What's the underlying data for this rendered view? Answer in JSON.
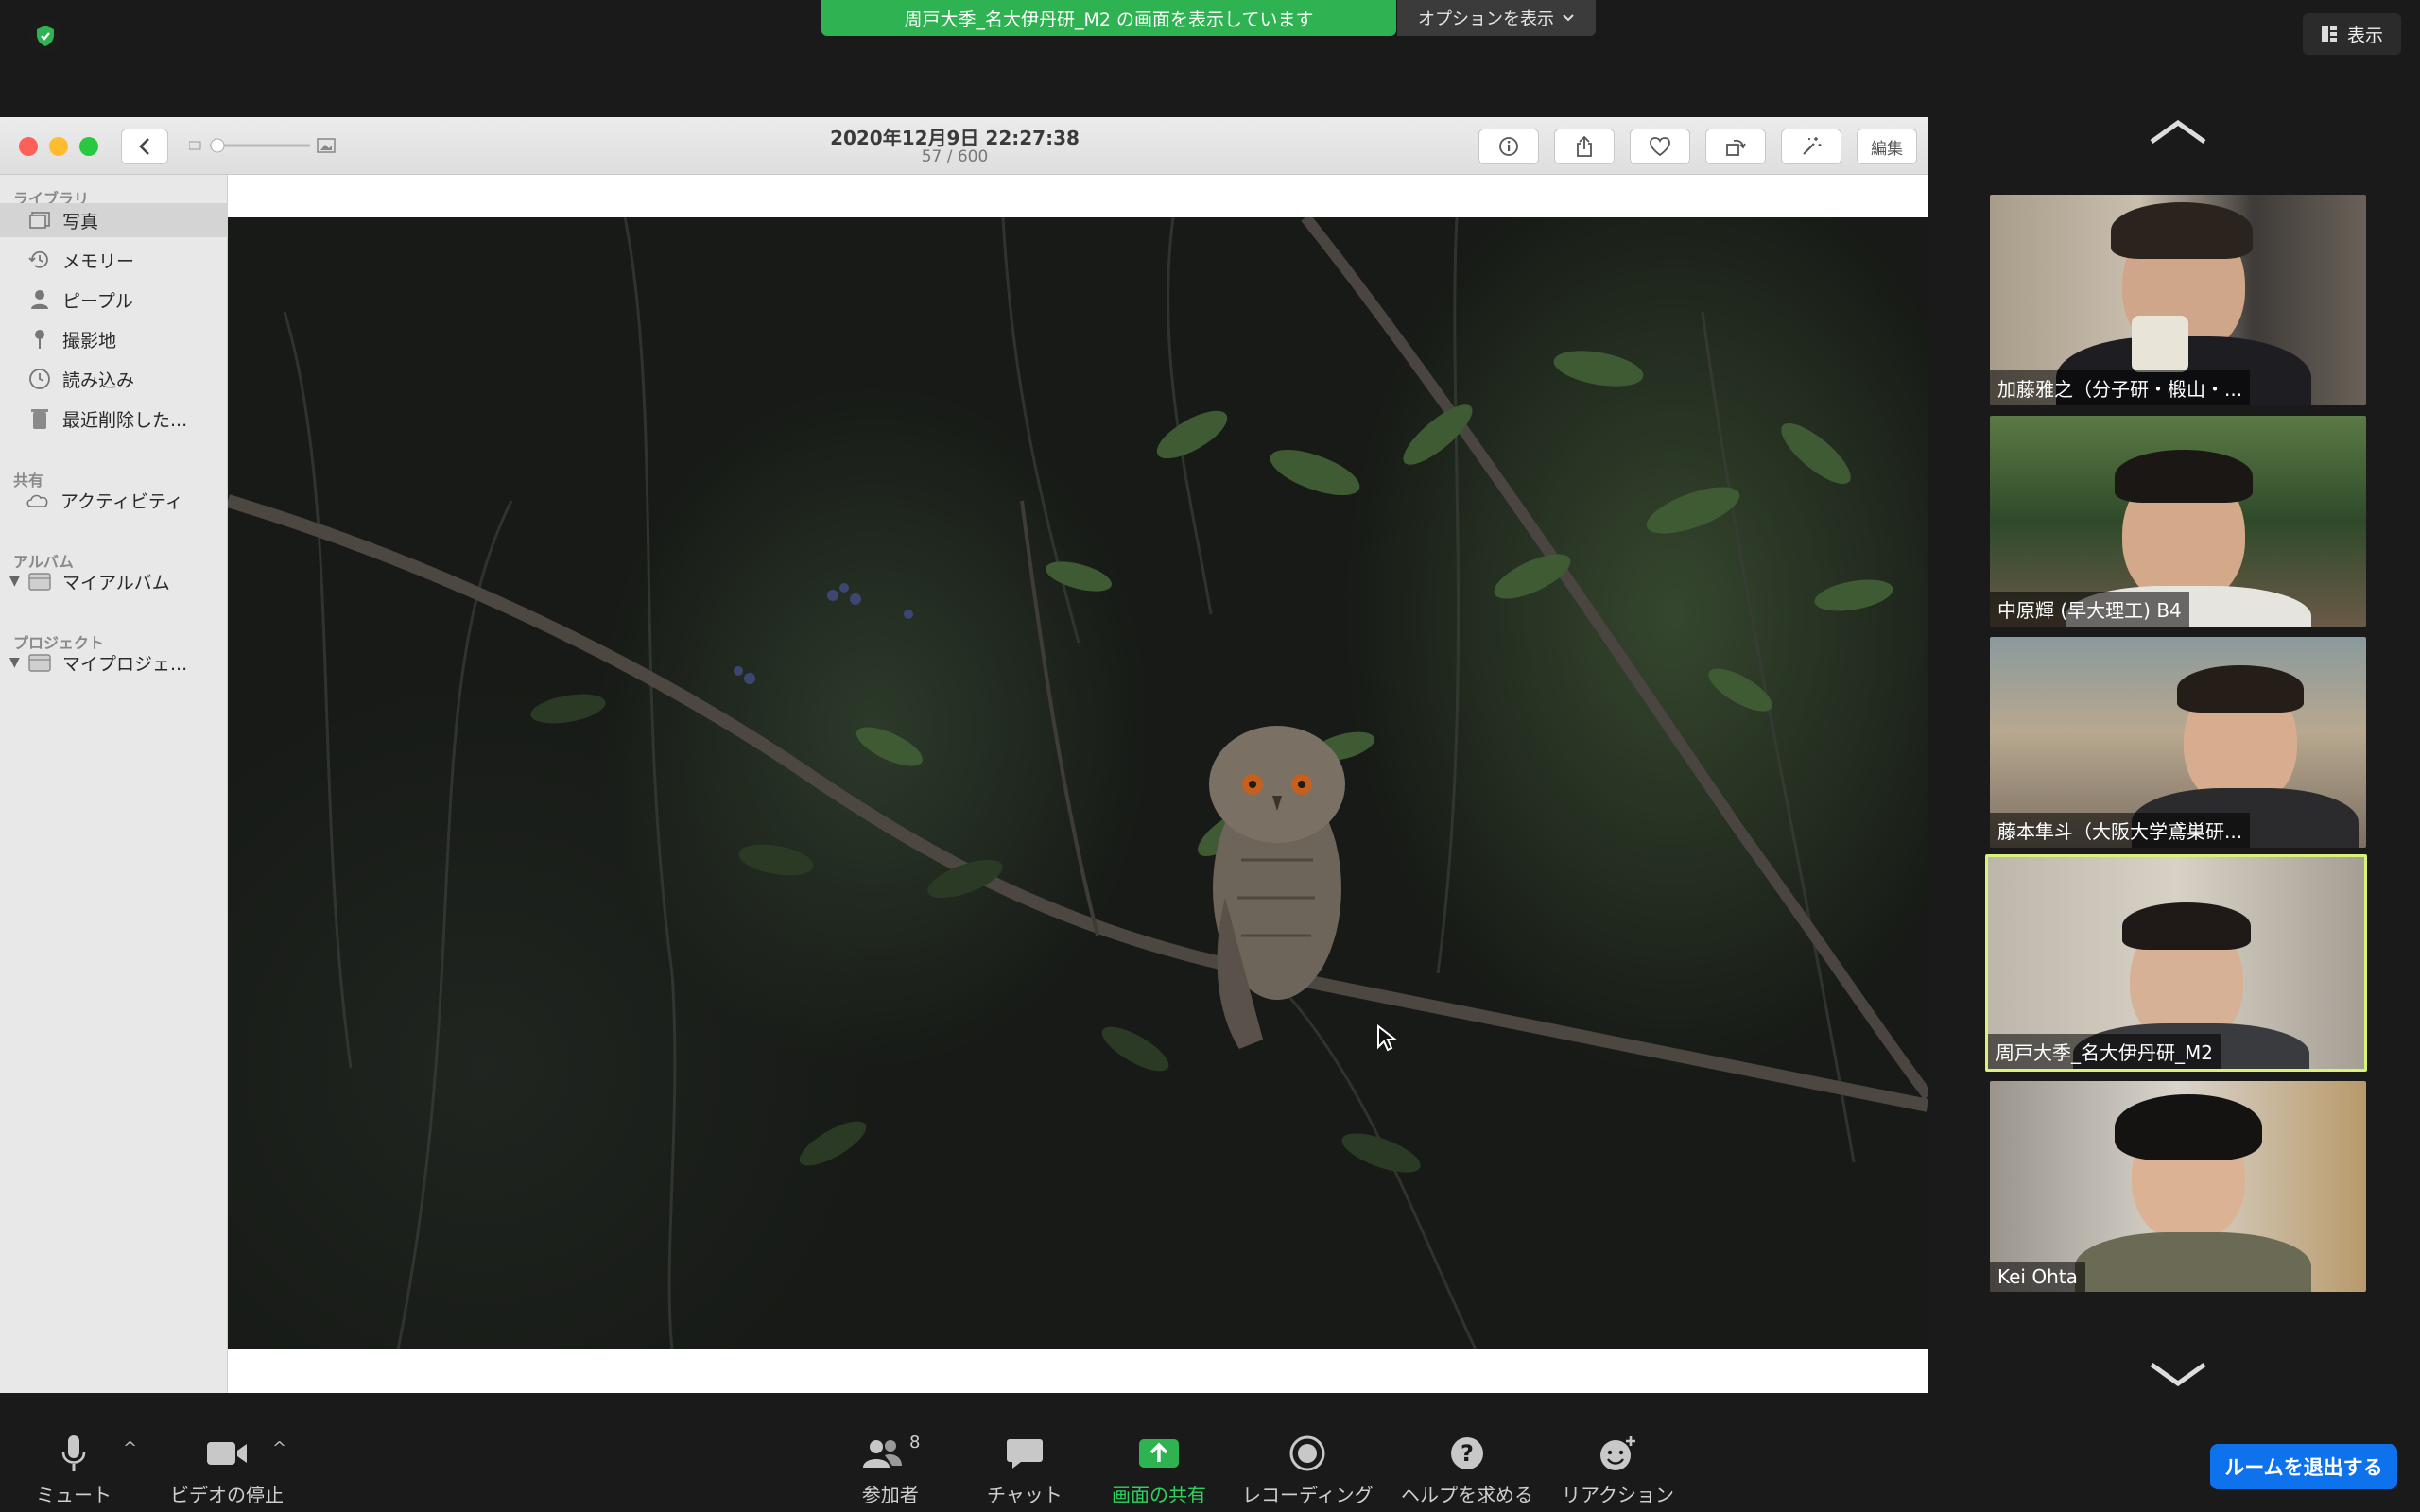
{
  "zoom": {
    "share_banner": "周戸大季_名大伊丹研_M2 の画面を表示しています",
    "options_label": "オプションを表示",
    "view_label": "表示",
    "leave_label": "ルームを退出する",
    "participant_count": "8",
    "toolbar": {
      "mute": "ミュート",
      "video": "ビデオの停止",
      "participants": "参加者",
      "chat": "チャット",
      "share": "画面の共有",
      "record": "レコーディング",
      "help": "ヘルプを求める",
      "reaction": "リアクション"
    },
    "participants": [
      {
        "name": "加藤雅之（分子研・椴山・..."
      },
      {
        "name": "中原輝 (早大理工) B4"
      },
      {
        "name": "藤本隼斗（大阪大学鳶巣研..."
      },
      {
        "name": "周戸大季_名大伊丹研_M2",
        "active": true
      },
      {
        "name": "Kei Ohta"
      }
    ]
  },
  "photos": {
    "date": "2020年12月9日 22:27:38",
    "count": "57 / 600",
    "edit_label": "編集",
    "sidebar": {
      "library_header": "ライブラリ",
      "library": [
        "写真",
        "メモリー",
        "ピープル",
        "撮影地",
        "読み込み",
        "最近削除した..."
      ],
      "shared_header": "共有",
      "shared": [
        "アクティビティ"
      ],
      "albums_header": "アルバム",
      "albums": [
        "マイアルバム"
      ],
      "projects_header": "プロジェクト",
      "projects": [
        "マイプロジェ..."
      ]
    }
  },
  "colors": {
    "share_green": "#2fb352",
    "leave_blue": "#0e72ed",
    "active_speaker": "#d9f27a"
  }
}
